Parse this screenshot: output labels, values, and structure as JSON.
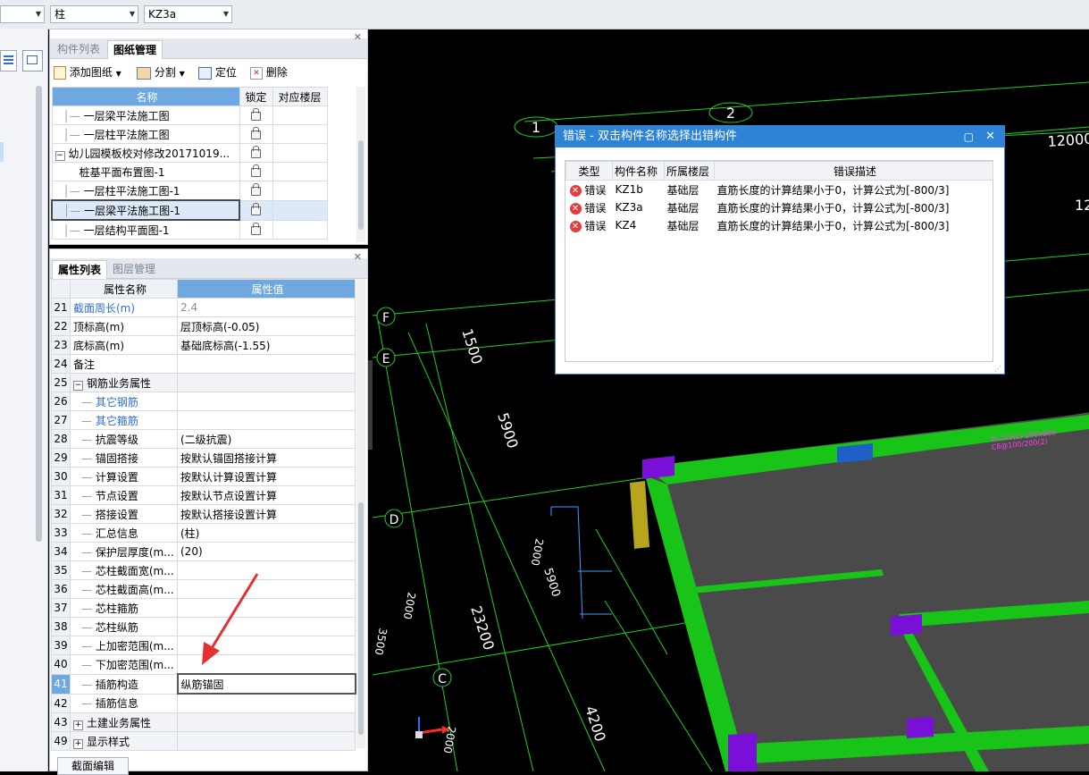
{
  "toolbar": {
    "combo1": "",
    "combo2": "柱",
    "combo3": "KZ3a"
  },
  "component_panel": {
    "tabs": [
      "构件列表",
      "图纸管理"
    ],
    "actions": {
      "add": "添加图纸",
      "split": "分割",
      "locate": "定位",
      "delete": "删除"
    },
    "headers": [
      "名称",
      "锁定",
      "对应楼层"
    ],
    "rows": [
      {
        "name": "一层梁平法施工图"
      },
      {
        "name": "一层柱平法施工图"
      },
      {
        "name": "幼儿园模板校对修改20171019..."
      },
      {
        "name": "桩基平面布置图-1"
      },
      {
        "name": "一层柱平法施工图-1"
      },
      {
        "name": "一层梁平法施工图-1"
      },
      {
        "name": "一层结构平面图-1"
      }
    ]
  },
  "property_panel": {
    "tabs": [
      "属性列表",
      "图层管理"
    ],
    "headers": [
      "属性名称",
      "属性值"
    ],
    "rows": [
      {
        "no": "21",
        "name": "截面周长(m)",
        "value": "2.4"
      },
      {
        "no": "22",
        "name": "顶标高(m)",
        "value": "层顶标高(-0.05)"
      },
      {
        "no": "23",
        "name": "底标高(m)",
        "value": "基础底标高(-1.55)"
      },
      {
        "no": "24",
        "name": "备注",
        "value": ""
      },
      {
        "no": "25",
        "name": "钢筋业务属性",
        "value": ""
      },
      {
        "no": "26",
        "name": "其它钢筋",
        "value": ""
      },
      {
        "no": "27",
        "name": "其它箍筋",
        "value": ""
      },
      {
        "no": "28",
        "name": "抗震等级",
        "value": "(二级抗震)"
      },
      {
        "no": "29",
        "name": "锚固搭接",
        "value": "按默认锚固搭接计算"
      },
      {
        "no": "30",
        "name": "计算设置",
        "value": "按默认计算设置计算"
      },
      {
        "no": "31",
        "name": "节点设置",
        "value": "按默认节点设置计算"
      },
      {
        "no": "32",
        "name": "搭接设置",
        "value": "按默认搭接设置计算"
      },
      {
        "no": "33",
        "name": "汇总信息",
        "value": "(柱)"
      },
      {
        "no": "34",
        "name": "保护层厚度(m...",
        "value": "(20)"
      },
      {
        "no": "35",
        "name": "芯柱截面宽(m...",
        "value": ""
      },
      {
        "no": "36",
        "name": "芯柱截面高(m...",
        "value": ""
      },
      {
        "no": "37",
        "name": "芯柱箍筋",
        "value": ""
      },
      {
        "no": "38",
        "name": "芯柱纵筋",
        "value": ""
      },
      {
        "no": "39",
        "name": "上加密范围(m...",
        "value": ""
      },
      {
        "no": "40",
        "name": "下加密范围(m...",
        "value": ""
      },
      {
        "no": "41",
        "name": "插筋构造",
        "value": "纵筋锚固"
      },
      {
        "no": "42",
        "name": "插筋信息",
        "value": ""
      },
      {
        "no": "43",
        "name": "土建业务属性",
        "value": ""
      },
      {
        "no": "49",
        "name": "显示样式",
        "value": ""
      }
    ],
    "bottom_button": "截面编辑"
  },
  "error_dialog": {
    "title": "错误 - 双击构件名称选择出错构件",
    "headers": [
      "类型",
      "构件名称",
      "所属楼层",
      "错误描述"
    ],
    "rows": [
      {
        "type": "错误",
        "name": "KZ1b",
        "floor": "基础层",
        "desc": "直筋长度的计算结果小于0，计算公式为[-800/3]"
      },
      {
        "type": "错误",
        "name": "KZ3a",
        "floor": "基础层",
        "desc": "直筋长度的计算结果小于0，计算公式为[-800/3]"
      },
      {
        "type": "错误",
        "name": "KZ4",
        "floor": "基础层",
        "desc": "直筋长度的计算结果小于0，计算公式为[-800/3]"
      }
    ]
  },
  "cad": {
    "axis_labels": [
      "1",
      "2",
      "F",
      "E",
      "D",
      "C"
    ],
    "dims": [
      "12000",
      "12",
      "1500",
      "5900",
      "23200",
      "4200",
      "5900",
      "2000",
      "2000",
      "3500",
      "2000"
    ],
    "colors": {
      "green": "#17c417",
      "purple": "#7a10d8",
      "slab": "#4a4a4a",
      "grid": "#1fd01f"
    }
  }
}
